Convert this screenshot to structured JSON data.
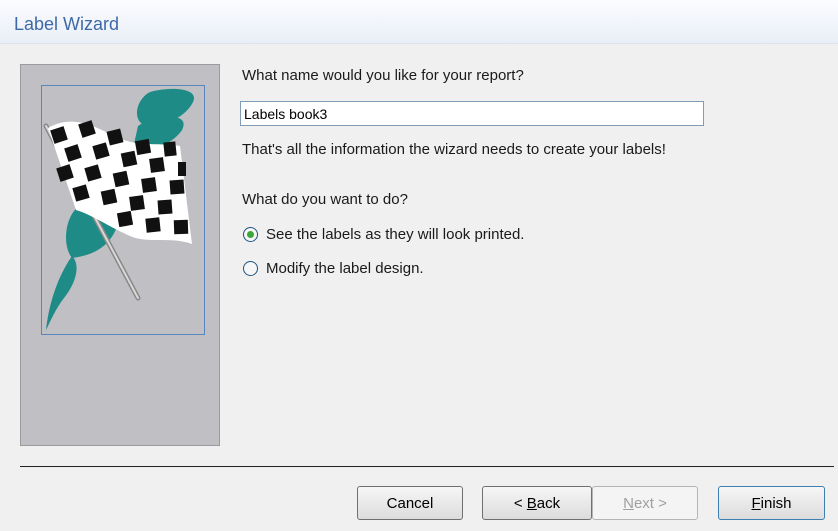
{
  "window": {
    "title": "Label Wizard"
  },
  "art": {
    "icon": "checkered-flag-icon"
  },
  "form": {
    "question": "What name would you like for your report?",
    "report_name_value": "Labels book3",
    "info": "That's all the information the wizard needs to create your labels!",
    "action_question": "What do you want to do?",
    "options": [
      {
        "label": "See the labels as they will look printed.",
        "checked": true
      },
      {
        "label": "Modify the label design.",
        "checked": false
      }
    ]
  },
  "buttons": {
    "cancel": "Cancel",
    "back_prefix": "< ",
    "back_accel": "B",
    "back_rest": "ack",
    "next_accel": "N",
    "next_rest": "ext >",
    "finish_accel": "F",
    "finish_rest": "inish"
  },
  "colors": {
    "title": "#3d6aa6",
    "accent": "#3c7fb1",
    "radio_dot": "#3aa73a"
  }
}
